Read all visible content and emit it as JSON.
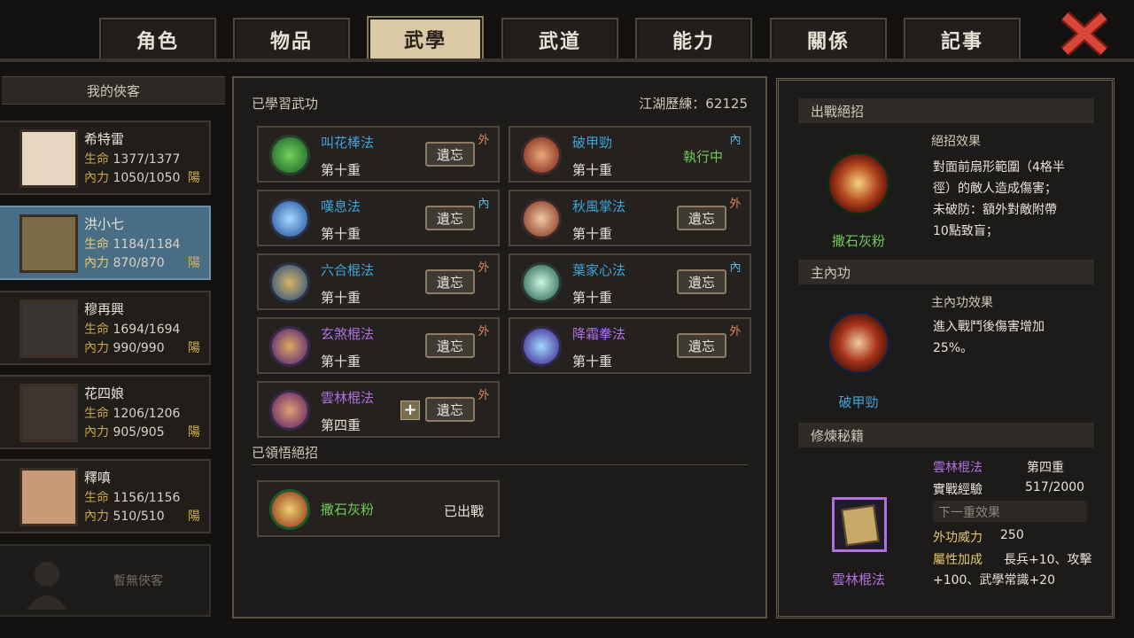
{
  "tabs": [
    "角色",
    "物品",
    "武學",
    "武道",
    "能力",
    "關係",
    "記事"
  ],
  "active_tab": 2,
  "sidebar": {
    "title": "我的俠客",
    "heroes": [
      {
        "name": "希特雷",
        "hp_label": "生命",
        "hp": "1377/1377",
        "mp_label": "內力",
        "mp": "1050/1050",
        "align": "陽"
      },
      {
        "name": "洪小七",
        "hp_label": "生命",
        "hp": "1184/1184",
        "mp_label": "內力",
        "mp": "870/870",
        "align": "陽"
      },
      {
        "name": "穆再興",
        "hp_label": "生命",
        "hp": "1694/1694",
        "mp_label": "內力",
        "mp": "990/990",
        "align": "陽"
      },
      {
        "name": "花四娘",
        "hp_label": "生命",
        "hp": "1206/1206",
        "mp_label": "內力",
        "mp": "905/905",
        "align": "陽"
      },
      {
        "name": "釋嗔",
        "hp_label": "生命",
        "hp": "1156/1156",
        "mp_label": "內力",
        "mp": "510/510",
        "align": "陽"
      }
    ],
    "empty_slot": "暫無俠客"
  },
  "skills": {
    "title": "已學習武功",
    "exp_label": "江湖歷練：62125",
    "forget_label": "遺忘",
    "running_label": "執行中",
    "list": [
      {
        "name": "叫花棒法",
        "level": "第十重",
        "type": "外",
        "icon_color": "#3fae4a"
      },
      {
        "name": "破甲勁",
        "level": "第十重",
        "type": "內",
        "icon_color": "#b8402a",
        "running": true
      },
      {
        "name": "嘆息法",
        "level": "第十重",
        "type": "內",
        "icon_color": "#3a8be0"
      },
      {
        "name": "秋風掌法",
        "level": "第十重",
        "type": "外",
        "icon_color": "#c05a3a"
      },
      {
        "name": "六合棍法",
        "level": "第十重",
        "type": "外",
        "icon_color": "#3c7fc0"
      },
      {
        "name": "葉家心法",
        "level": "第十重",
        "type": "內",
        "icon_color": "#3fb07f"
      },
      {
        "name": "玄煞棍法",
        "level": "第十重",
        "type": "外",
        "icon_color": "#8a4ad0"
      },
      {
        "name": "降霜拳法",
        "level": "第十重",
        "type": "外",
        "icon_color": "#6a4ad8"
      },
      {
        "name": "雲林棍法",
        "level": "第四重",
        "type": "外",
        "icon_color": "#9a45c0",
        "plus": true
      }
    ]
  },
  "ultimates": {
    "title": "已領悟絕招",
    "list": [
      {
        "name": "撒石灰粉",
        "status": "已出戰"
      }
    ]
  },
  "right": {
    "battle": {
      "header": "出戰絕招",
      "skill_name": "撒石灰粉",
      "effect_title": "絕招效果",
      "effect_lines": [
        "對面前扇形範圍（4格半",
        "徑）的敵人造成傷害；",
        "未破防：額外對敵附帶",
        "10點致盲；"
      ]
    },
    "inner": {
      "header": "主內功",
      "skill_name": "破甲勁",
      "effect_title": "主內功效果",
      "effect_lines": [
        "進入戰鬥後傷害增加",
        "25%。"
      ]
    },
    "book": {
      "header": "修煉秘籍",
      "name": "雲林棍法",
      "level": "第四重",
      "exp_label": "實戰經驗",
      "exp_value": "517/2000",
      "next_label": "下一重效果",
      "power_label": "外功威力",
      "power_value": "250",
      "attr_label": "屬性加成",
      "attr_value1": "長兵+10、攻擊",
      "attr_value2": "+100、武學常識+20",
      "caption": "雲林棍法"
    }
  },
  "colors": {
    "accent": "#d9c9a6",
    "skill_name": "#3ea4d9",
    "running": "#6fca59",
    "purple": "#b070e0",
    "green": "#6fca59"
  }
}
